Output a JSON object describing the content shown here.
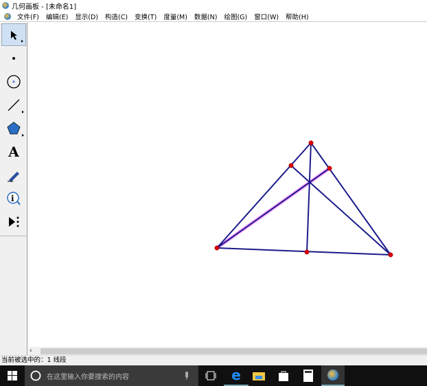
{
  "window": {
    "title": "几何画板 - [未命名1]"
  },
  "menu": [
    "文件(F)",
    "编辑(E)",
    "显示(D)",
    "构造(C)",
    "变换(T)",
    "度量(M)",
    "数据(N)",
    "绘图(G)",
    "窗口(W)",
    "帮助(H)"
  ],
  "tools": [
    "arrow-select-tool",
    "point-tool",
    "compass-tool",
    "straightedge-tool",
    "polygon-tool",
    "text-tool",
    "marker-tool",
    "information-tool",
    "custom-tool"
  ],
  "text_tool_glyph": "A",
  "status": "当前被选中的：1 线段",
  "taskbar": {
    "search_placeholder": "在这里输入你要搜索的内容"
  },
  "colors": {
    "segment": "#1a1a8c",
    "point": "#e00000",
    "selection": "#ff88ff"
  }
}
